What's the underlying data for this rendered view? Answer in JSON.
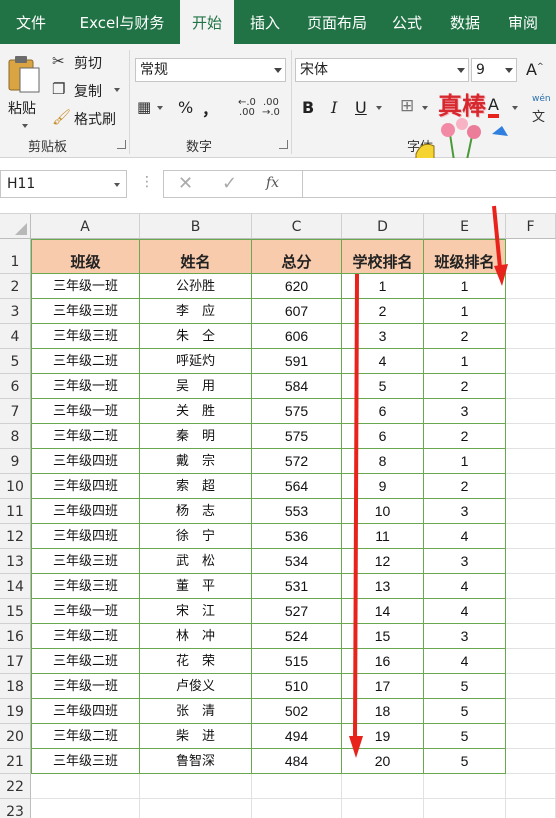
{
  "tabs": [
    {
      "label": "文件",
      "active": false
    },
    {
      "label": "Excel与财务",
      "active": false
    },
    {
      "label": "开始",
      "active": true
    },
    {
      "label": "插入",
      "active": false
    },
    {
      "label": "页面布局",
      "active": false
    },
    {
      "label": "公式",
      "active": false
    },
    {
      "label": "数据",
      "active": false
    },
    {
      "label": "审阅",
      "active": false
    }
  ],
  "ribbon": {
    "clipboard": {
      "paste": "粘贴",
      "cut": "剪切",
      "copy": "复制",
      "format_painter": "格式刷",
      "group": "剪贴板"
    },
    "number": {
      "format": "常规",
      "percent": "%",
      "comma": "，",
      "group": "数字"
    },
    "font": {
      "name": "宋体",
      "size": "9",
      "bold": "B",
      "italic": "I",
      "underline": "U",
      "color_letter": "A",
      "group": "字体",
      "wen_label": "wén"
    },
    "sticker": {
      "text": "真棒"
    }
  },
  "formula_bar": {
    "name_box": "H11",
    "fx": "fx",
    "value": ""
  },
  "columns": [
    "A",
    "B",
    "C",
    "D",
    "E",
    "F"
  ],
  "row_numbers": [
    "1",
    "2",
    "3",
    "4",
    "5",
    "6",
    "7",
    "8",
    "9",
    "10",
    "11",
    "12",
    "13",
    "14",
    "15",
    "16",
    "17",
    "18",
    "19",
    "20",
    "21",
    "22",
    "23"
  ],
  "table": {
    "headers": [
      "班级",
      "姓名",
      "总分",
      "学校排名",
      "班级排名"
    ],
    "rows": [
      [
        "三年级一班",
        "公孙胜",
        "620",
        "1",
        "1"
      ],
      [
        "三年级三班",
        "李　应",
        "607",
        "2",
        "1"
      ],
      [
        "三年级三班",
        "朱　仝",
        "606",
        "3",
        "2"
      ],
      [
        "三年级二班",
        "呼延灼",
        "591",
        "4",
        "1"
      ],
      [
        "三年级一班",
        "吴　用",
        "584",
        "5",
        "2"
      ],
      [
        "三年级一班",
        "关　胜",
        "575",
        "6",
        "3"
      ],
      [
        "三年级二班",
        "秦　明",
        "575",
        "6",
        "2"
      ],
      [
        "三年级四班",
        "戴　宗",
        "572",
        "8",
        "1"
      ],
      [
        "三年级四班",
        "索　超",
        "564",
        "9",
        "2"
      ],
      [
        "三年级四班",
        "杨　志",
        "553",
        "10",
        "3"
      ],
      [
        "三年级四班",
        "徐　宁",
        "536",
        "11",
        "4"
      ],
      [
        "三年级三班",
        "武　松",
        "534",
        "12",
        "3"
      ],
      [
        "三年级三班",
        "董　平",
        "531",
        "13",
        "4"
      ],
      [
        "三年级一班",
        "宋　江",
        "527",
        "14",
        "4"
      ],
      [
        "三年级二班",
        "林　冲",
        "524",
        "15",
        "3"
      ],
      [
        "三年级二班",
        "花　荣",
        "515",
        "16",
        "4"
      ],
      [
        "三年级一班",
        "卢俊义",
        "510",
        "17",
        "5"
      ],
      [
        "三年级四班",
        "张　清",
        "502",
        "18",
        "5"
      ],
      [
        "三年级二班",
        "柴　进",
        "494",
        "19",
        "5"
      ],
      [
        "三年级三班",
        "鲁智深",
        "484",
        "20",
        "5"
      ]
    ]
  },
  "colors": {
    "accent": "#217346",
    "header_fill": "#f8cbad",
    "border": "#6aa84f",
    "arrow": "#e8231b"
  }
}
